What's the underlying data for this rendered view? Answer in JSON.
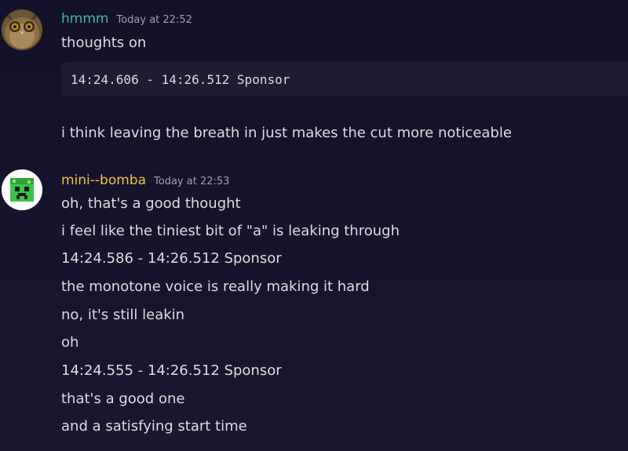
{
  "messages": [
    {
      "author": "hmmm",
      "author_color": "#3fb8a0",
      "timestamp": "Today at 22:52",
      "avatar": "owl-avatar",
      "lines": {
        "first": "thoughts on",
        "code": "14:24.606 - 14:26.512 Sponsor",
        "last": "i think leaving the breath in just makes the cut more noticeable"
      }
    },
    {
      "author": "mini--bomba",
      "author_color": "#e8c53b",
      "timestamp": "Today at 22:53",
      "avatar": "green-block-avatar",
      "lines": [
        "oh, that's a good thought",
        "i feel like the tiniest bit of \"a\" is leaking through",
        "14:24.586 - 14:26.512 Sponsor",
        "the monotone voice is really making it hard",
        "no, it's still leakin",
        "oh",
        "14:24.555 - 14:26.512 Sponsor",
        "that's a good one",
        "and a satisfying start time"
      ]
    }
  ]
}
